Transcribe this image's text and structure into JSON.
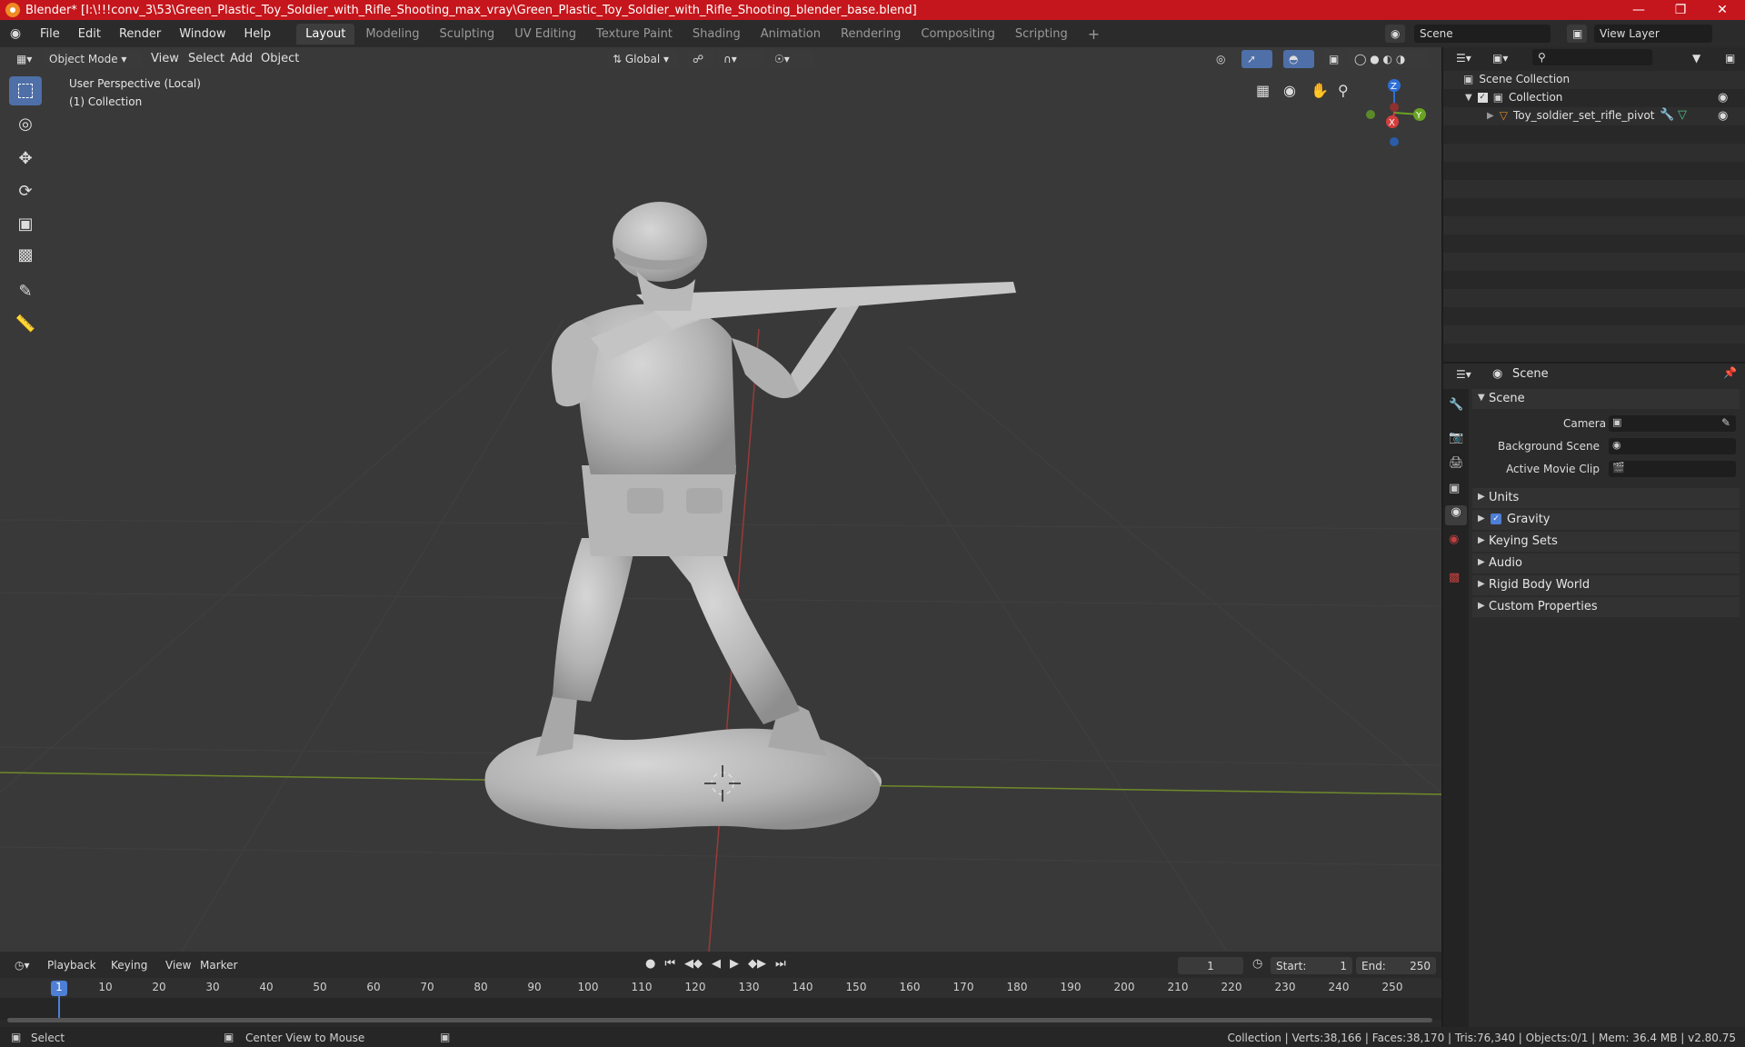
{
  "window": {
    "title": "Blender* [I:\\!!!conv_3\\53\\Green_Plastic_Toy_Soldier_with_Rifle_Shooting_max_vray\\Green_Plastic_Toy_Soldier_with_Rifle_Shooting_blender_base.blend]"
  },
  "menu": [
    "File",
    "Edit",
    "Render",
    "Window",
    "Help"
  ],
  "workspaces": [
    "Layout",
    "Modeling",
    "Sculpting",
    "UV Editing",
    "Texture Paint",
    "Shading",
    "Animation",
    "Rendering",
    "Compositing",
    "Scripting"
  ],
  "active_workspace": "Layout",
  "scene_field": "Scene",
  "view_layer_field": "View Layer",
  "viewport": {
    "mode": "Object Mode",
    "menus": [
      "View",
      "Select",
      "Add",
      "Object"
    ],
    "transform_orientation": "Global",
    "overlay_line1": "User Perspective (Local)",
    "overlay_line2": "(1) Collection",
    "gizmo": {
      "z": "Z",
      "y": "Y",
      "x": "X"
    }
  },
  "outliner": {
    "scene_collection": "Scene Collection",
    "collection": "Collection",
    "object": "Toy_soldier_set_rifle_pivot"
  },
  "properties": {
    "header": "Scene",
    "panel": "Scene",
    "camera_label": "Camera",
    "bg_scene_label": "Background Scene",
    "movie_clip_label": "Active Movie Clip",
    "sections": [
      "Units",
      "Gravity",
      "Keying Sets",
      "Audio",
      "Rigid Body World",
      "Custom Properties"
    ]
  },
  "timeline": {
    "menus": [
      "Playback",
      "Keying",
      "View",
      "Marker"
    ],
    "current_frame": "1",
    "start_label": "Start:",
    "start": "1",
    "end_label": "End:",
    "end": "250",
    "ticks": [
      "1",
      "10",
      "20",
      "30",
      "40",
      "50",
      "60",
      "70",
      "80",
      "90",
      "100",
      "110",
      "120",
      "130",
      "140",
      "150",
      "160",
      "170",
      "180",
      "190",
      "200",
      "210",
      "220",
      "230",
      "240",
      "250"
    ]
  },
  "status": {
    "left": "Select",
    "middle": "Center View to Mouse",
    "right": "Collection | Verts:38,166 | Faces:38,170 | Tris:76,340 | Objects:0/1 | Mem: 36.4 MB | v2.80.75"
  }
}
